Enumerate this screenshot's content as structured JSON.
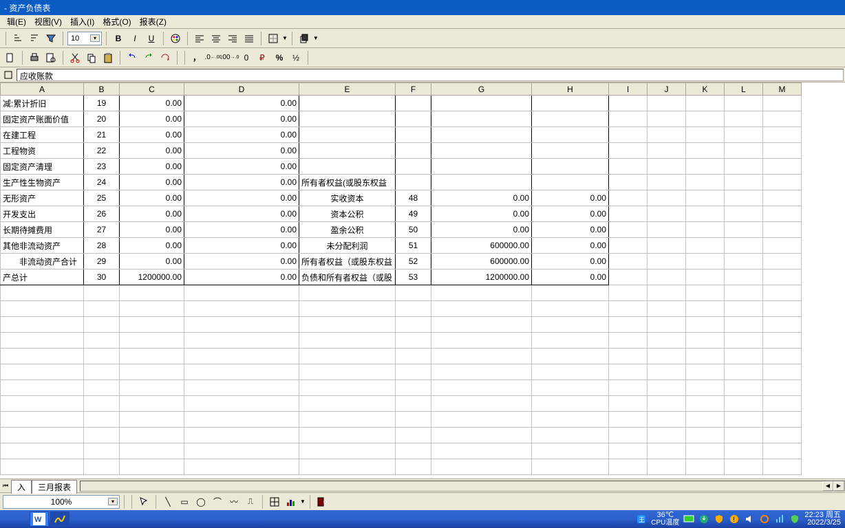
{
  "titlebar": {
    "title": " - 资产负债表"
  },
  "menu": {
    "edit": "辑(E)",
    "view": "视图(V)",
    "insert": "插入(I)",
    "format": "格式(O)",
    "report": "报表(Z)"
  },
  "toolbar": {
    "font_size": "10",
    "comma": "，",
    "zero_inc": ".0",
    "zero_dec": ".00",
    "zero": "0",
    "percent": "%",
    "half": "½"
  },
  "formula": {
    "cell_content": "应收账款"
  },
  "columns": [
    "A",
    "B",
    "C",
    "D",
    "E",
    "F",
    "G",
    "H",
    "I",
    "J",
    "K",
    "L",
    "M"
  ],
  "rows": [
    {
      "a": "减:累计折旧",
      "b": "19",
      "c": "0.00",
      "d": "0.00",
      "e": "",
      "f": "",
      "g": "",
      "h": ""
    },
    {
      "a": "固定资产账面价值",
      "b": "20",
      "c": "0.00",
      "d": "0.00",
      "e": "",
      "f": "",
      "g": "",
      "h": ""
    },
    {
      "a": "在建工程",
      "b": "21",
      "c": "0.00",
      "d": "0.00",
      "e": "",
      "f": "",
      "g": "",
      "h": ""
    },
    {
      "a": "工程物资",
      "b": "22",
      "c": "0.00",
      "d": "0.00",
      "e": "",
      "f": "",
      "g": "",
      "h": ""
    },
    {
      "a": "固定资产清理",
      "b": "23",
      "c": "0.00",
      "d": "0.00",
      "e": "",
      "f": "",
      "g": "",
      "h": ""
    },
    {
      "a": "生产性生物资产",
      "b": "24",
      "c": "0.00",
      "d": "0.00",
      "e": "所有者权益(或股东权益",
      "f": "",
      "g": "",
      "h": ""
    },
    {
      "a": "无形资产",
      "b": "25",
      "c": "0.00",
      "d": "0.00",
      "e": "实收资本",
      "f": "48",
      "g": "0.00",
      "h": "0.00"
    },
    {
      "a": "开发支出",
      "b": "26",
      "c": "0.00",
      "d": "0.00",
      "e": "资本公积",
      "f": "49",
      "g": "0.00",
      "h": "0.00"
    },
    {
      "a": "长期待摊费用",
      "b": "27",
      "c": "0.00",
      "d": "0.00",
      "e": "盈余公积",
      "f": "50",
      "g": "0.00",
      "h": "0.00"
    },
    {
      "a": "其他非流动资产",
      "b": "28",
      "c": "0.00",
      "d": "0.00",
      "e": "未分配利润",
      "f": "51",
      "g": "600000.00",
      "h": "0.00"
    },
    {
      "a": "　　非流动资产合计",
      "b": "29",
      "c": "0.00",
      "d": "0.00",
      "e": "所有者权益（或股东权益",
      "f": "52",
      "g": "600000.00",
      "h": "0.00"
    },
    {
      "a": "产总计",
      "b": "30",
      "c": "1200000.00",
      "d": "0.00",
      "e": "负债和所有者权益（或股",
      "f": "53",
      "g": "1200000.00",
      "h": "0.00"
    }
  ],
  "tabs": {
    "tab1": "入",
    "tab2": "三月报表"
  },
  "zoom": {
    "value": "100%"
  },
  "status": {
    "temp": "36℃",
    "temp_label": "CPU温度",
    "time": "22:23",
    "day": "周五",
    "date": "2022/3/25"
  }
}
